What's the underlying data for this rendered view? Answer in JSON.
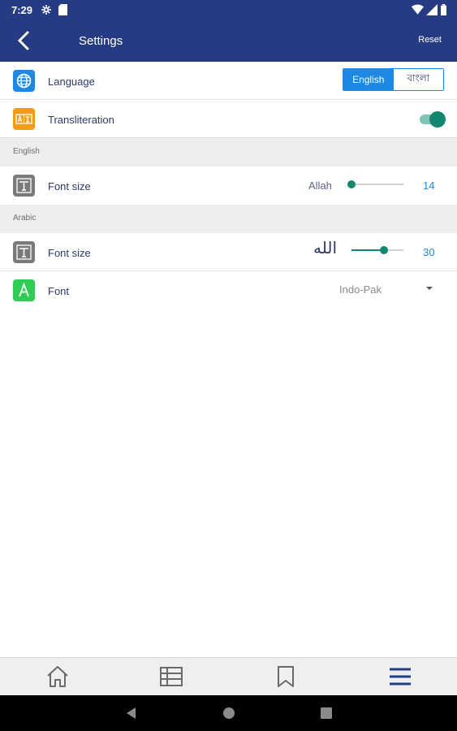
{
  "status": {
    "time": "7:29"
  },
  "appbar": {
    "title": "Settings",
    "reset_label": "Reset"
  },
  "language": {
    "label": "Language",
    "options": [
      "English",
      "বাংলা"
    ],
    "selected": "English"
  },
  "transliteration": {
    "label": "Transliteration",
    "enabled": true
  },
  "english_section": {
    "header": "English",
    "font_size_label": "Font size",
    "preview": "Allah",
    "value": "14",
    "level": 0.0
  },
  "arabic_section": {
    "header": "Arabic",
    "font_size_label": "Font size",
    "preview": "الله",
    "value": "30",
    "level": 0.62,
    "font_label": "Font",
    "font_value": "Indo-Pak"
  },
  "nav": {
    "items": [
      "home-icon",
      "list-icon",
      "bookmark-icon",
      "menu-icon"
    ],
    "active": "menu-icon"
  },
  "colors": {
    "primary": "#253c85",
    "accent": "#1e88e5",
    "toggle": "#12876f"
  }
}
